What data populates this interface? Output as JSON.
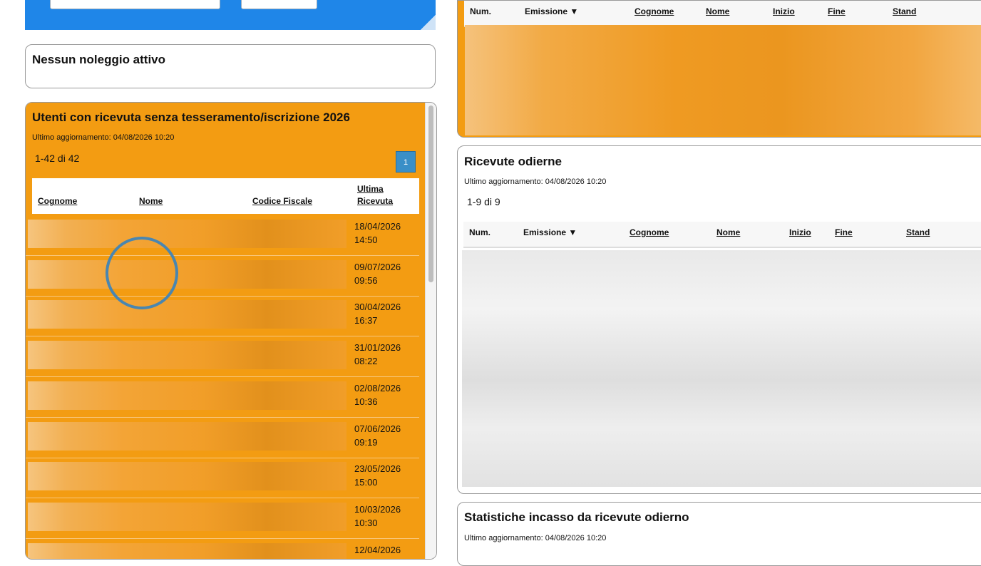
{
  "no_rentals": {
    "title": "Nessun noleggio attivo"
  },
  "users_panel": {
    "title": "Utenti con ricevuta senza tesseramento/iscrizione 2026",
    "updated": "Ultimo aggiornamento: 04/08/2026 10:20",
    "range": "1-42 di 42",
    "page": "1",
    "columns": {
      "surname": "Cognome",
      "name": "Nome",
      "tax_code": "Codice Fiscale",
      "last_receipt_1": "Ultima",
      "last_receipt_2": "Ricevuta"
    },
    "rows": [
      {
        "date": "18/04/2026",
        "time": "14:50"
      },
      {
        "date": "09/07/2026",
        "time": "09:56"
      },
      {
        "date": "30/04/2026",
        "time": "16:37"
      },
      {
        "date": "31/01/2026",
        "time": "08:22"
      },
      {
        "date": "02/08/2026",
        "time": "10:36"
      },
      {
        "date": "07/06/2026",
        "time": "09:19"
      },
      {
        "date": "23/05/2026",
        "time": "15:00"
      },
      {
        "date": "10/03/2026",
        "time": "10:30"
      },
      {
        "date": "12/04/2026",
        "time": ""
      }
    ]
  },
  "top_table": {
    "columns": {
      "num": "Num.",
      "issue": "Emissione ▼",
      "surname": "Cognome",
      "name": "Nome",
      "start": "Inizio",
      "end": "Fine",
      "stand": "Stand"
    }
  },
  "receipts_panel": {
    "title": "Ricevute odierne",
    "updated": "Ultimo aggiornamento: 04/08/2026 10:20",
    "range": "1-9 di 9",
    "columns": {
      "num": "Num.",
      "issue": "Emissione ▼",
      "surname": "Cognome",
      "name": "Nome",
      "start": "Inizio",
      "end": "Fine",
      "stand": "Stand"
    }
  },
  "stats_panel": {
    "title": "Statistiche incasso da ricevute odierno",
    "updated": "Ultimo aggiornamento: 04/08/2026 10:20"
  }
}
